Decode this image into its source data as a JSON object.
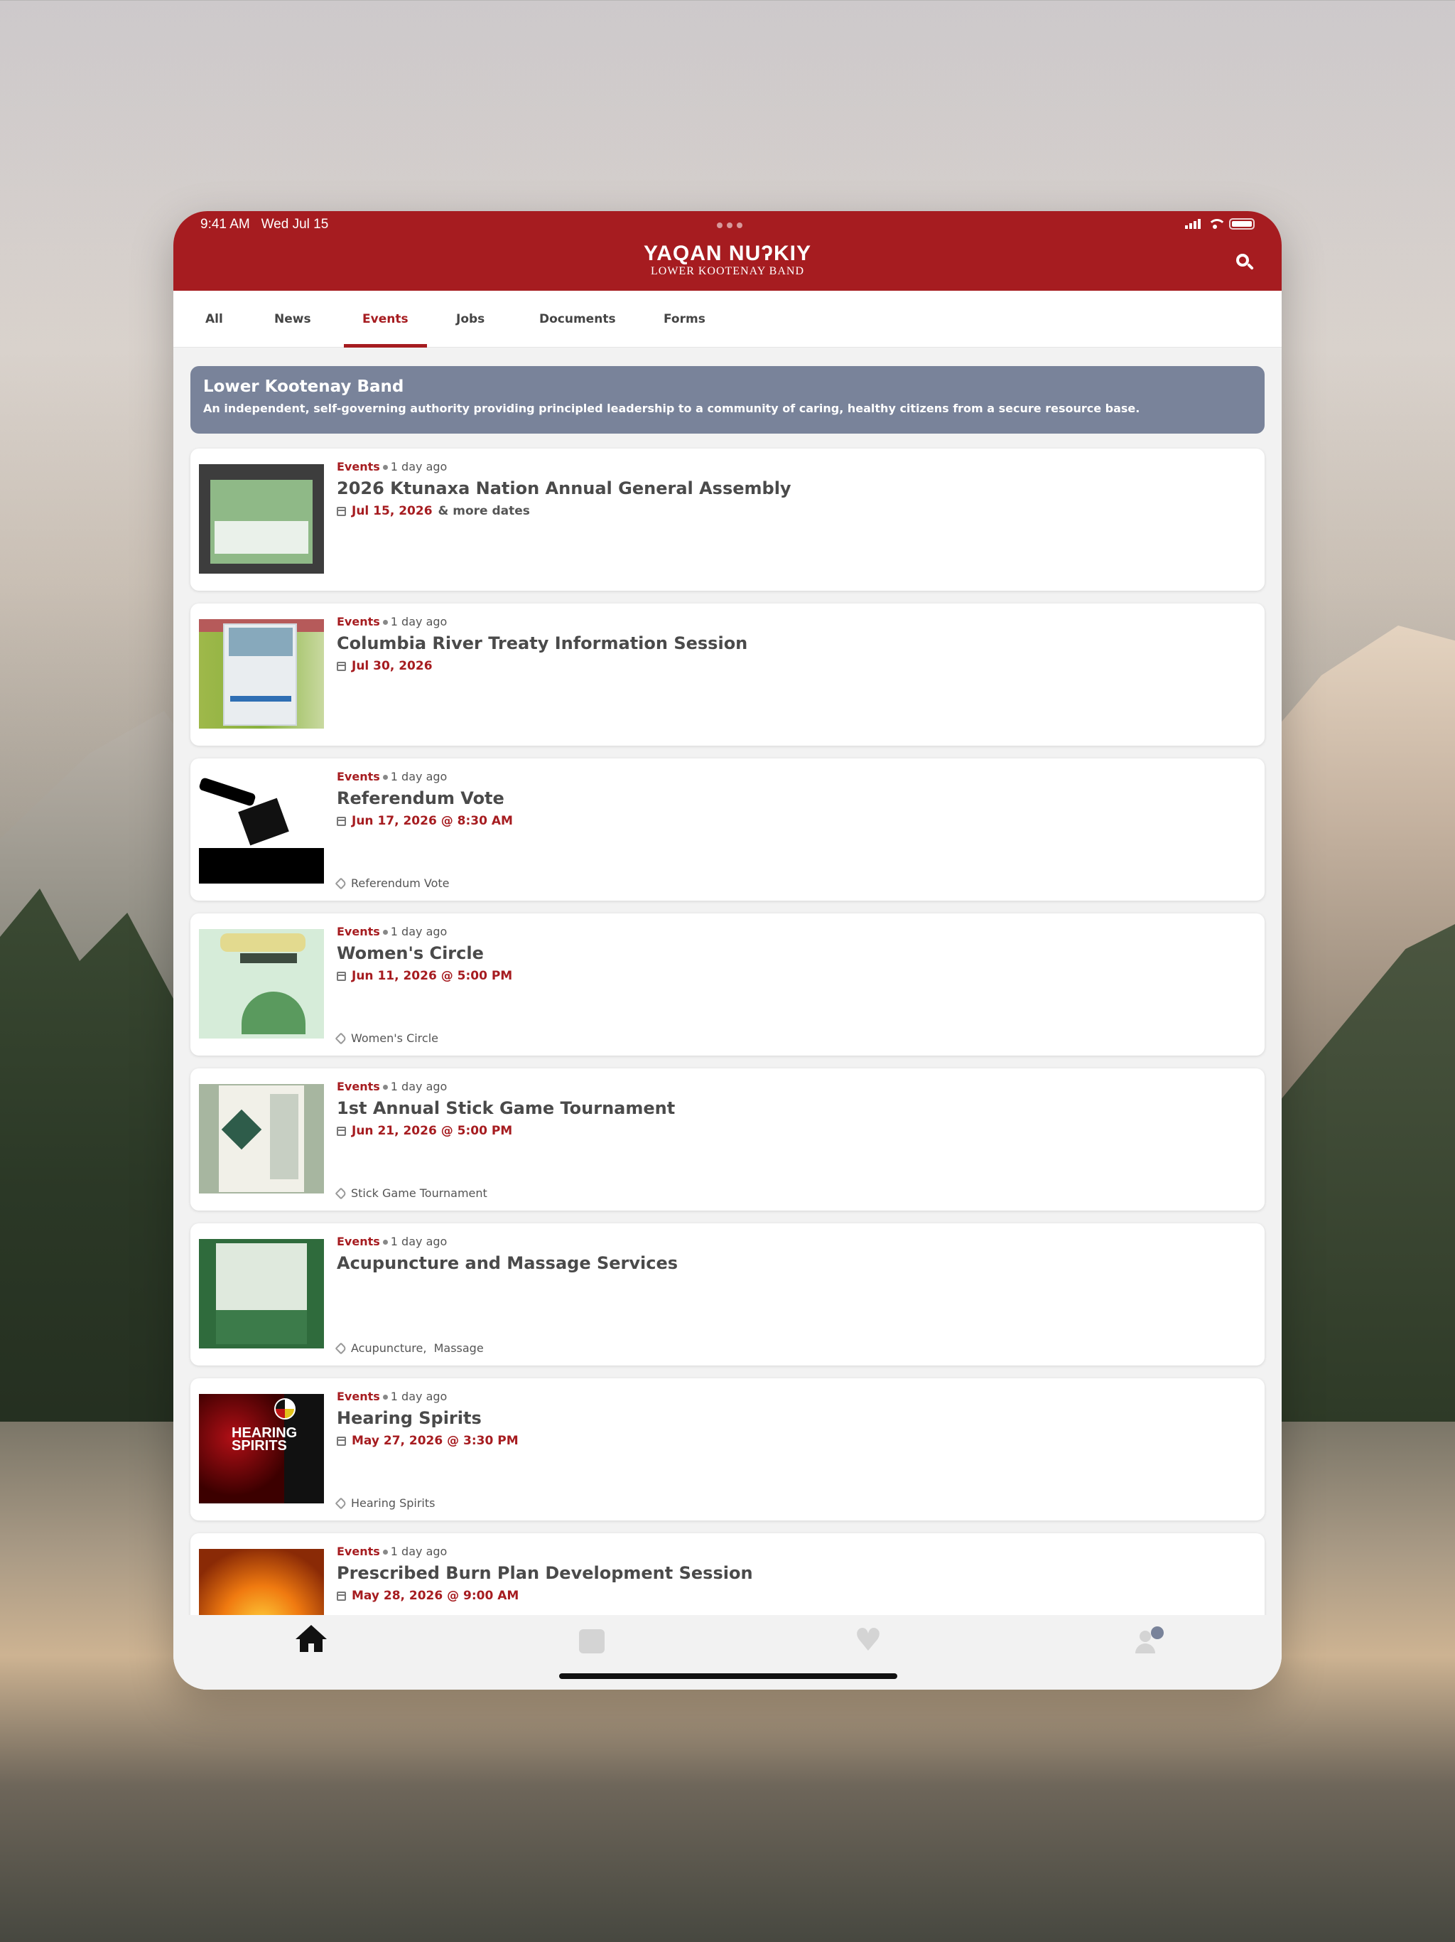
{
  "status_bar": {
    "time": "9:41 AM",
    "date": "Wed Jul 15"
  },
  "header": {
    "brand_main": "YAQAN NUʔKIY",
    "brand_sub": "LOWER KOOTENAY BAND",
    "search_icon": "search-icon",
    "color": "#a61c20"
  },
  "tabs": [
    {
      "label": "All",
      "active": false
    },
    {
      "label": "News",
      "active": false
    },
    {
      "label": "Events",
      "active": true
    },
    {
      "label": "Jobs",
      "active": false
    },
    {
      "label": "Documents",
      "active": false
    },
    {
      "label": "Forms",
      "active": false
    }
  ],
  "banner": {
    "title": "Lower Kootenay Band",
    "text": "An independent, self-governing authority providing principled leadership to a community of caring, healthy citizens from a secure resource base.",
    "color": "#79839a"
  },
  "cards": [
    {
      "category": "Events",
      "time_ago": "1 day ago",
      "title": "2026 Ktunaxa Nation Annual General Assembly",
      "date": "Jul 15, 2026",
      "more": "& more dates",
      "tags": ""
    },
    {
      "category": "Events",
      "time_ago": "1 day ago",
      "title": "Columbia River Treaty Information Session",
      "date": "Jul 30, 2026",
      "more": "",
      "tags": ""
    },
    {
      "category": "Events",
      "time_ago": "1 day ago",
      "title": "Referendum Vote",
      "date": "Jun 17, 2026 @ 8:30 AM",
      "more": "",
      "tags": "Referendum Vote"
    },
    {
      "category": "Events",
      "time_ago": "1 day ago",
      "title": "Women's Circle",
      "date": "Jun 11, 2026 @ 5:00 PM",
      "more": "",
      "tags": "Women's Circle"
    },
    {
      "category": "Events",
      "time_ago": "1 day ago",
      "title": "1st Annual Stick Game Tournament",
      "date": "Jun 21, 2026 @ 5:00 PM",
      "more": "",
      "tags": "Stick Game Tournament"
    },
    {
      "category": "Events",
      "time_ago": "1 day ago",
      "title": "Acupuncture and Massage Services",
      "date": "",
      "more": "",
      "tags": "Acupuncture,  Massage"
    },
    {
      "category": "Events",
      "time_ago": "1 day ago",
      "title": "Hearing Spirits",
      "date": "May 27, 2026 @ 3:30 PM",
      "more": "",
      "tags": "Hearing Spirits",
      "thumb_text": "HEARING SPIRITS"
    },
    {
      "category": "Events",
      "time_ago": "1 day ago",
      "title": "Prescribed Burn Plan Development Session",
      "date": "May 28, 2026 @ 9:00 AM",
      "more": "",
      "tags": ""
    }
  ],
  "bottom_nav": [
    {
      "icon": "home-icon",
      "active": true
    },
    {
      "icon": "calendar-icon",
      "active": false
    },
    {
      "icon": "heart-icon",
      "active": false
    },
    {
      "icon": "user-icon",
      "active": false
    }
  ]
}
